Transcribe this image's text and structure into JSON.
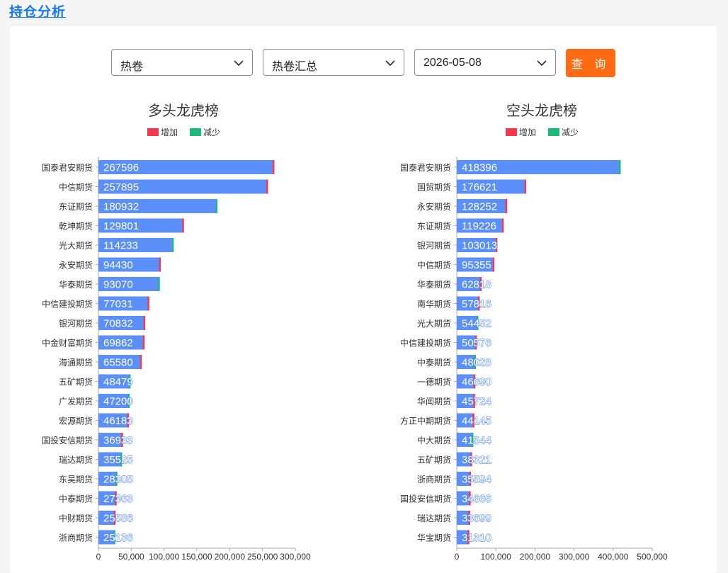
{
  "page": {
    "title": "持仓分析"
  },
  "filters": {
    "variety": "热卷",
    "contract": "热卷汇总",
    "date": "2026-05-08",
    "query_label": "查 询"
  },
  "colors": {
    "bar": "#5b8ff9",
    "increase": "#f5394c",
    "decrease": "#1db87a"
  },
  "legend": {
    "increase": "增加",
    "decrease": "减少"
  },
  "chart_data": [
    {
      "type": "bar",
      "orientation": "horizontal",
      "title": "多头龙虎榜",
      "categories": [
        "国泰君安期货",
        "中信期货",
        "东证期货",
        "乾坤期货",
        "光大期货",
        "永安期货",
        "华泰期货",
        "中信建投期货",
        "银河期货",
        "中金财富期货",
        "海通期货",
        "五矿期货",
        "广发期货",
        "宏源期货",
        "国投安信期货",
        "瑞达期货",
        "东吴期货",
        "中泰期货",
        "中财期货",
        "浙商期货"
      ],
      "series": [
        {
          "name": "增加",
          "values": [
            267596,
            257895,
            180932,
            129801,
            114233,
            94430,
            93070,
            77031,
            70832,
            69862,
            65580,
            48479,
            47200,
            46183,
            36933,
            35525,
            28305,
            27363,
            25586,
            25136
          ]
        }
      ],
      "changes": [
        "increase",
        "increase",
        "decrease",
        "increase",
        "decrease",
        "increase",
        "decrease",
        "increase",
        "increase",
        "increase",
        "increase",
        "decrease",
        "decrease",
        "increase",
        "increase",
        "decrease",
        "decrease",
        "increase",
        "increase",
        "decrease"
      ],
      "xticks": [
        "0",
        "50,000",
        "100,000",
        "150,000",
        "200,000",
        "250,000",
        "300,000"
      ],
      "xlim": [
        0,
        300000
      ],
      "legend": "top"
    },
    {
      "type": "bar",
      "orientation": "horizontal",
      "title": "空头龙虎榜",
      "categories": [
        "国泰君安期货",
        "国贸期货",
        "永安期货",
        "东证期货",
        "银河期货",
        "中信期货",
        "华泰期货",
        "南华期货",
        "光大期货",
        "中信建投期货",
        "中泰期货",
        "一德期货",
        "华闻期货",
        "方正中期期货",
        "中大期货",
        "五矿期货",
        "浙商期货",
        "国投安信期货",
        "瑞达期货",
        "华宝期货"
      ],
      "series": [
        {
          "name": "增加",
          "values": [
            418396,
            176621,
            128252,
            119226,
            103013,
            95355,
            62818,
            57816,
            54452,
            50576,
            48028,
            46690,
            45724,
            44145,
            41544,
            38321,
            35594,
            34666,
            33699,
            31310
          ]
        }
      ],
      "changes": [
        "decrease",
        "increase",
        "increase",
        "increase",
        "increase",
        "increase",
        "increase",
        "increase",
        "decrease",
        "increase",
        "decrease",
        "increase",
        "increase",
        "increase",
        "decrease",
        "increase",
        "increase",
        "increase",
        "increase",
        "increase"
      ],
      "xticks": [
        "0",
        "100,000",
        "200,000",
        "300,000",
        "400,000",
        "500,000"
      ],
      "xlim": [
        0,
        500000
      ],
      "legend": "top"
    }
  ]
}
